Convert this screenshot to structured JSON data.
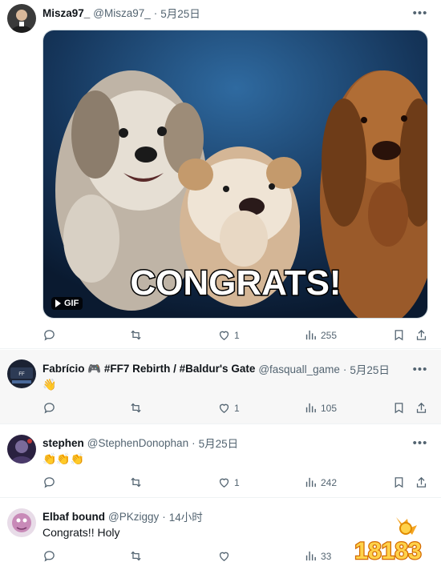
{
  "tweets": [
    {
      "name": "Misza97_",
      "handle": "@Misza97_",
      "time": "5月25日",
      "media": {
        "type": "GIF",
        "caption": "CONGRATS!",
        "badge": "GIF"
      },
      "stats": {
        "reply": "",
        "retweet": "",
        "like": "1",
        "views": "255"
      }
    },
    {
      "name": "Fabrício 🎮 #FF7 Rebirth / #Baldur's Gate",
      "handle": "@fasquall_game",
      "time": "5月25日",
      "text": "👋",
      "stats": {
        "reply": "",
        "retweet": "",
        "like": "1",
        "views": "105"
      }
    },
    {
      "name": "stephen",
      "handle": "@StephenDonophan",
      "time": "5月25日",
      "text": "👏👏👏",
      "stats": {
        "reply": "",
        "retweet": "",
        "like": "1",
        "views": "242"
      }
    },
    {
      "name": "Elbaf bound",
      "handle": "@PKziggy",
      "time": "14小时",
      "text": "Congrats!! Holy",
      "stats": {
        "reply": "",
        "retweet": "",
        "like": "",
        "views": "33"
      }
    }
  ],
  "watermark": {
    "text": "18183"
  },
  "icons": [
    "more-icon",
    "reply-icon",
    "retweet-icon",
    "like-icon",
    "views-icon",
    "bookmark-icon",
    "share-icon"
  ],
  "colors": {
    "text": "#0f1419",
    "secondary": "#536471",
    "border": "#eff3f4",
    "alt_bg": "#f7f7f7"
  }
}
